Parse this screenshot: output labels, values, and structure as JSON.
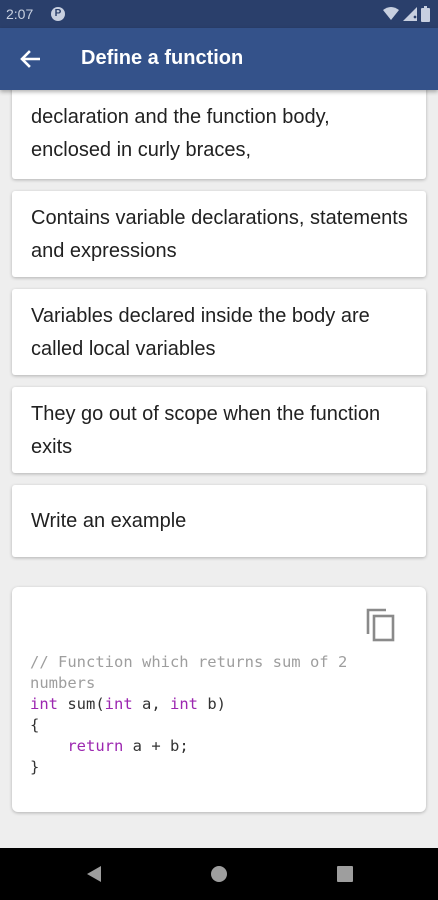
{
  "status_bar": {
    "time": "2:07",
    "icons": [
      "p-app-icon",
      "wifi-icon",
      "signal-icon",
      "battery-icon"
    ]
  },
  "app_bar": {
    "title": "Define a function",
    "back_icon": "arrow-back-icon"
  },
  "cards": [
    {
      "text": "A function definition consists of the declaration and the function body, enclosed in curly braces,"
    },
    {
      "text": "Contains variable declarations, statements and expressions"
    },
    {
      "text": "Variables declared inside the body are called local variables"
    },
    {
      "text": "They go out of scope when the function exits"
    },
    {
      "text": "Write an example"
    }
  ],
  "code_card": {
    "copy_icon": "copy-icon",
    "lines": {
      "comment": "// Function which returns sum of 2 numbers",
      "kw_int1": "int",
      "sig_mid1": " sum(",
      "kw_int2": "int",
      "sig_mid2": " a, ",
      "kw_int3": "int",
      "sig_end": " b)",
      "open_brace": "{",
      "indent": "    ",
      "kw_return": "return",
      "return_expr": " a + b;",
      "close_brace": "}"
    }
  },
  "nav_bar": {
    "icons": [
      "back-triangle-icon",
      "home-circle-icon",
      "recents-square-icon"
    ]
  },
  "colors": {
    "app_bar": "#34528a",
    "status_bar": "#2a3f6b",
    "keyword": "#9c27b0",
    "comment": "#9e9e9e"
  }
}
